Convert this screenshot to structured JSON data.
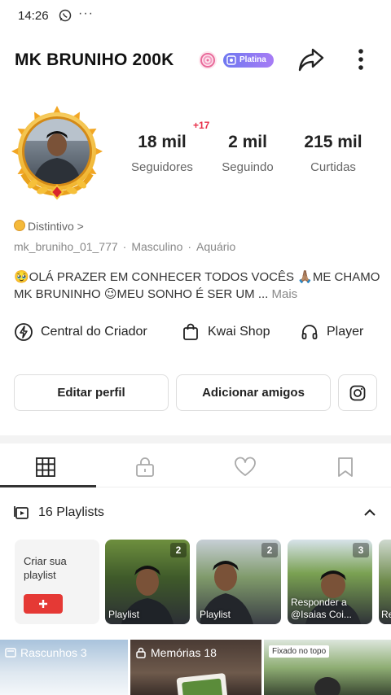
{
  "status": {
    "time": "14:26",
    "more": "···"
  },
  "profile": {
    "name": "MK BRUNIHO 200K",
    "badge_label": "Platina",
    "plus_count": "+17",
    "stats": [
      {
        "value": "18 mil",
        "label": "Seguidores"
      },
      {
        "value": "2 mil",
        "label": "Seguindo"
      },
      {
        "value": "215 mil",
        "label": "Curtidas"
      }
    ],
    "distintivo": "Distintivo >",
    "username": "mk_bruniho_01_777",
    "gender": "Masculino",
    "sign": "Aquário",
    "bio": "🥹OLÁ PRAZER EM CONHECER TODOS VOCÊS 🙏🏽ME CHAMO MK BRUNINHO 😉MEU SONHO É SER UM ...",
    "bio_more": "Mais"
  },
  "quick_links": {
    "creator": "Central do Criador",
    "shop": "Kwai Shop",
    "player": "Player"
  },
  "buttons": {
    "edit": "Editar perfil",
    "add_friends": "Adicionar amigos"
  },
  "playlists": {
    "header": "16 Playlists",
    "create_label": "Criar sua playlist",
    "items": [
      {
        "count": "2",
        "caption": "Playlist"
      },
      {
        "count": "2",
        "caption": "Playlist"
      },
      {
        "count": "3",
        "caption": "Responder a @Isaias Coi..."
      },
      {
        "count": "",
        "caption": "Re"
      }
    ]
  },
  "bottom_row": {
    "drafts": "Rascunhos 3",
    "memories": "Memórias 18",
    "pinned": "Fixado no topo"
  },
  "colors": {
    "accent_red": "#e8304a",
    "badge_purple": "#8b7af3",
    "youtube_red": "#e53935"
  }
}
